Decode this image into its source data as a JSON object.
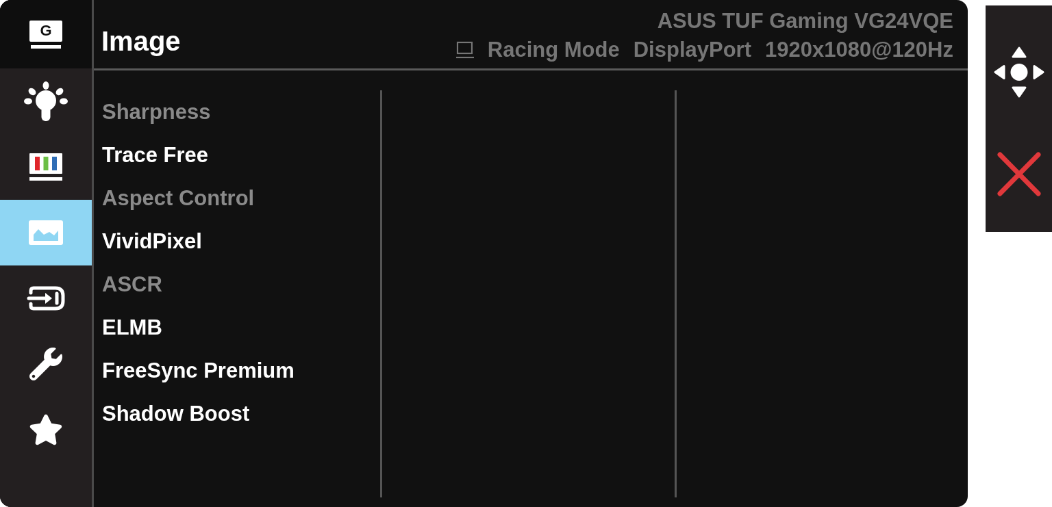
{
  "sidebar": {
    "items": [
      {
        "kind": "gaming",
        "label": "G",
        "selected": false
      },
      {
        "kind": "bluelight",
        "selected": false
      },
      {
        "kind": "color",
        "selected": false
      },
      {
        "kind": "image",
        "selected": true
      },
      {
        "kind": "input",
        "selected": false
      },
      {
        "kind": "system",
        "selected": false
      },
      {
        "kind": "favorite",
        "selected": false
      }
    ]
  },
  "header": {
    "title": "Image",
    "model": "ASUS TUF Gaming VG24VQE",
    "status": [
      "Racing Mode",
      "DisplayPort",
      "1920x1080@120Hz"
    ]
  },
  "menu": {
    "items": [
      {
        "label": "Sharpness",
        "disabled": true
      },
      {
        "label": "Trace Free",
        "disabled": false
      },
      {
        "label": "Aspect Control",
        "disabled": true
      },
      {
        "label": "VividPixel",
        "disabled": false
      },
      {
        "label": "ASCR",
        "disabled": true
      },
      {
        "label": "ELMB",
        "disabled": false
      },
      {
        "label": "FreeSync Premium",
        "disabled": false
      },
      {
        "label": "Shadow Boost",
        "disabled": false
      }
    ]
  }
}
